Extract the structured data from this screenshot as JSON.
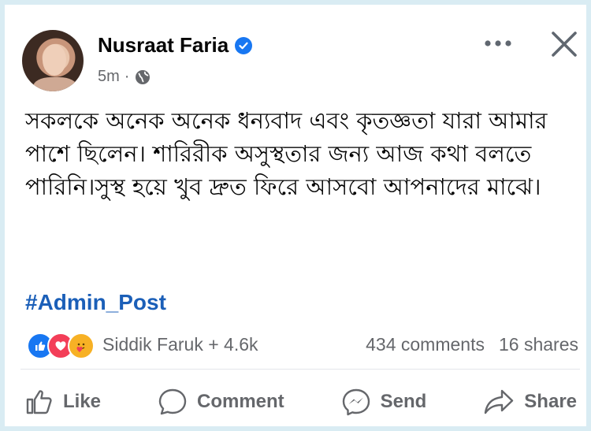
{
  "post": {
    "author": "Nusraat Faria",
    "time": "5m",
    "separator": "·",
    "privacy_icon": "globe-icon",
    "verified_icon": "verified-badge-icon",
    "text": "সকলকে অনেক অনেক ধন্যবাদ এবং কৃতজ্ঞতা যারা আমার পাশে ছিলেন। শারিরীক অসুস্থতার জন্য আজ কথা বলতে পারিনি।সুস্থ হয়ে খুব দ্রুত ফিরে আসবো আপনাদের মাঝে।",
    "hashtag": "#Admin_Post"
  },
  "reactions": {
    "icons": [
      "like-reaction-icon",
      "love-reaction-icon",
      "care-reaction-icon"
    ],
    "names": "Siddik Faruk + 4.6k",
    "comments": "434 comments",
    "shares": "16 shares"
  },
  "actions": {
    "like": "Like",
    "comment": "Comment",
    "send": "Send",
    "share": "Share"
  },
  "colors": {
    "accent": "#1877f2",
    "hashtag": "#1b5fb8",
    "love": "#f33e58",
    "care": "#f7b125",
    "muted_text": "#65676b"
  }
}
